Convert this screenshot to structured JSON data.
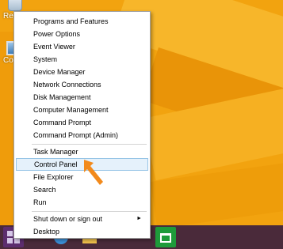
{
  "desktop": {
    "icons": [
      {
        "label": "Re"
      },
      {
        "label": "Co"
      }
    ]
  },
  "menu": {
    "group1": [
      "Programs and Features",
      "Power Options",
      "Event Viewer",
      "System",
      "Device Manager",
      "Network Connections",
      "Disk Management",
      "Computer Management",
      "Command Prompt",
      "Command Prompt (Admin)"
    ],
    "group2": [
      "Task Manager",
      "Control Panel",
      "File Explorer",
      "Search",
      "Run"
    ],
    "group3": [
      "Shut down or sign out",
      "Desktop"
    ],
    "highlighted": "Control Panel",
    "submenu_arrow": "►"
  },
  "colors": {
    "desktop_bg": "#f2a30f",
    "highlight_bg": "#e5f1fb",
    "highlight_border": "#96c4e6",
    "pointer_arrow": "#f28a1c",
    "taskbar": "#4a2a3a",
    "store_green": "#1e9b3a"
  },
  "taskbar": {
    "items": [
      "start-icon",
      "internet-explorer-icon",
      "file-explorer-icon",
      "store-icon"
    ]
  }
}
